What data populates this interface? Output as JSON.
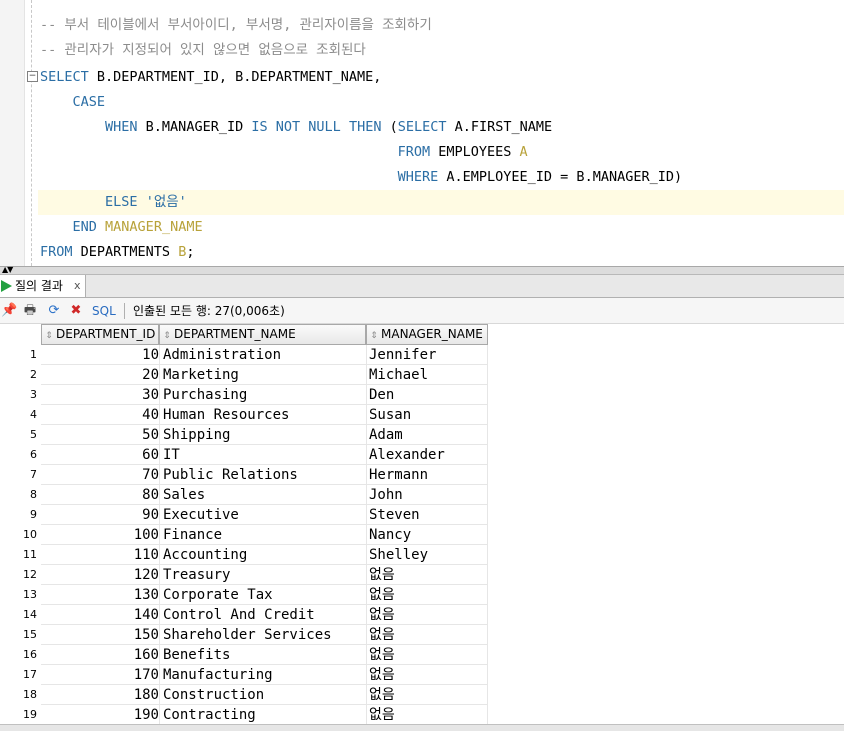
{
  "editor": {
    "comment_line_1": "-- 부서 테이블에서 부서아이디, 부서명, 관리자이름을 조회하기",
    "comment_line_2": "-- 관리자가 지정되어 있지 않으면 없음으로 조회된다",
    "select_kw": "SELECT",
    "select_cols": " B.DEPARTMENT_ID, B.DEPARTMENT_NAME,",
    "case_kw": "CASE",
    "when_kw": "WHEN",
    "when_expr": " B.MANAGER_ID ",
    "is_kw": "IS",
    "not_kw": "NOT",
    "null_kw": "NULL",
    "then_kw": "THEN",
    "paren_open": " (",
    "sub_select_kw": "SELECT",
    "sub_select_col": " A.FIRST_NAME",
    "sub_from_kw": "FROM",
    "sub_from_table": " EMPLOYEES ",
    "sub_from_alias": "A",
    "sub_where_kw": "WHERE",
    "sub_where_expr": " A.EMPLOYEE_ID = B.MANAGER_ID)",
    "else_kw": "ELSE",
    "else_value": "'없음'",
    "end_kw": "END",
    "end_alias": "MANAGER_NAME",
    "from_kw": "FROM",
    "from_table": " DEPARTMENTS ",
    "from_alias": "B",
    "from_end": ";",
    "fold_marker": "−"
  },
  "splitter": {
    "arrows": "▲▼"
  },
  "results_tab": {
    "label": "질의 결과",
    "close": "x"
  },
  "toolbar": {
    "pin_icon": "📌",
    "print_icon": "🖶",
    "refresh_icon": "⟳",
    "delete_icon": "✖",
    "sql_label": "SQL",
    "status": "인출된 모든 행: 27(0,006초)"
  },
  "grid": {
    "sort_glyph": "⇕",
    "columns": [
      "DEPARTMENT_ID",
      "DEPARTMENT_NAME",
      "MANAGER_NAME"
    ],
    "rows": [
      [
        "1",
        "10",
        "Administration",
        "Jennifer"
      ],
      [
        "2",
        "20",
        "Marketing",
        "Michael"
      ],
      [
        "3",
        "30",
        "Purchasing",
        "Den"
      ],
      [
        "4",
        "40",
        "Human Resources",
        "Susan"
      ],
      [
        "5",
        "50",
        "Shipping",
        "Adam"
      ],
      [
        "6",
        "60",
        "IT",
        "Alexander"
      ],
      [
        "7",
        "70",
        "Public Relations",
        "Hermann"
      ],
      [
        "8",
        "80",
        "Sales",
        "John"
      ],
      [
        "9",
        "90",
        "Executive",
        "Steven"
      ],
      [
        "10",
        "100",
        "Finance",
        "Nancy"
      ],
      [
        "11",
        "110",
        "Accounting",
        "Shelley"
      ],
      [
        "12",
        "120",
        "Treasury",
        "없음"
      ],
      [
        "13",
        "130",
        "Corporate Tax",
        "없음"
      ],
      [
        "14",
        "140",
        "Control And Credit",
        "없음"
      ],
      [
        "15",
        "150",
        "Shareholder Services",
        "없음"
      ],
      [
        "16",
        "160",
        "Benefits",
        "없음"
      ],
      [
        "17",
        "170",
        "Manufacturing",
        "없음"
      ],
      [
        "18",
        "180",
        "Construction",
        "없음"
      ],
      [
        "19",
        "190",
        "Contracting",
        "없음"
      ]
    ]
  }
}
